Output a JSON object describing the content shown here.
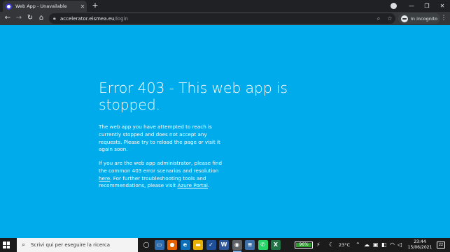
{
  "browser": {
    "tab": {
      "title": "Web App - Unavailable",
      "close": "✕"
    },
    "new_tab": "+",
    "window_controls": {
      "minimize": "—",
      "maximize": "❐",
      "close": "✕"
    },
    "nav": {
      "back": "←",
      "forward": "→",
      "reload": "↻",
      "home": "⌂"
    },
    "address": {
      "host": "accelerator.eismea.eu",
      "path": "/login"
    },
    "omnibox_icons": {
      "zoom": "⌕",
      "star": "☆"
    },
    "profile_label": "In incognito",
    "menu": "⋮"
  },
  "page": {
    "background": "#00abec",
    "heading": "Error 403 - This web app is stopped.",
    "paragraph1": "The web app you have attempted to reach is currently stopped and does not accept any requests. Please try to reload the page or visit it again soon.",
    "paragraph2": {
      "part1": "If you are the web app administrator, please find the common 403 error scenarios and resolution ",
      "link1": "here",
      "part2": ". For further troubleshooting tools and recommendations, please visit ",
      "link2": "Azure Portal",
      "part3": "."
    }
  },
  "taskbar": {
    "search_placeholder": "Scrivi qui per eseguire la ricerca",
    "search_icon": "⌕",
    "apps": [
      {
        "name": "cortana",
        "glyph": "◯",
        "color": "transparent"
      },
      {
        "name": "task-view",
        "glyph": "▭",
        "color": "#2b6cb0"
      },
      {
        "name": "firefox",
        "glyph": "●",
        "color": "#e66000"
      },
      {
        "name": "edge",
        "glyph": "e",
        "color": "#0c6fb8"
      },
      {
        "name": "file-explorer",
        "glyph": "▬",
        "color": "#e8b000"
      },
      {
        "name": "mail",
        "glyph": "✓",
        "color": "#1f4f99"
      },
      {
        "name": "word",
        "glyph": "W",
        "color": "#2b579a"
      },
      {
        "name": "chrome",
        "glyph": "◉",
        "color": "#5f6368"
      },
      {
        "name": "notepad",
        "glyph": "≡",
        "color": "#3d6fa8"
      },
      {
        "name": "whatsapp",
        "glyph": "✆",
        "color": "#25d366"
      },
      {
        "name": "excel",
        "glyph": "X",
        "color": "#217346"
      }
    ],
    "battery": "96%",
    "weather": "23°C",
    "time": "23:44",
    "date": "15/06/2021",
    "notifications": "22"
  }
}
